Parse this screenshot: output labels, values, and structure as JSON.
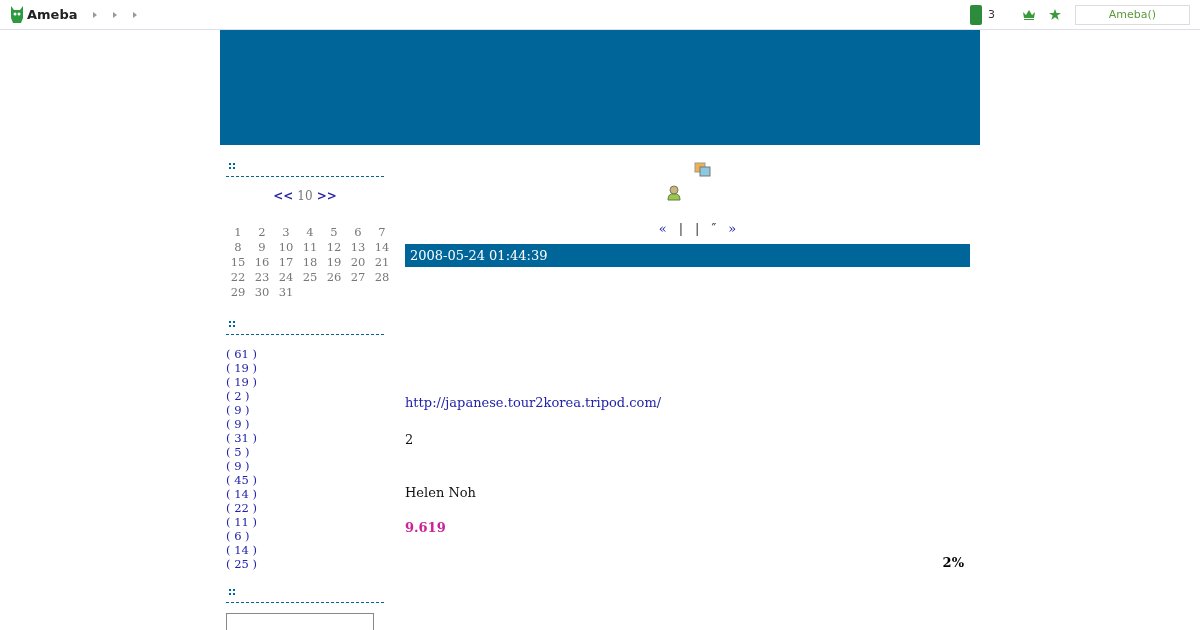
{
  "topbar": {
    "logo": "Ameba",
    "count": "3",
    "account_button": "Ameba()"
  },
  "calendar": {
    "prev": "<<",
    "month": "10",
    "next": ">>",
    "days": [
      "1",
      "2",
      "3",
      "4",
      "5",
      "6",
      "7",
      "8",
      "9",
      "10",
      "11",
      "12",
      "13",
      "14",
      "15",
      "16",
      "17",
      "18",
      "19",
      "20",
      "21",
      "22",
      "23",
      "24",
      "25",
      "26",
      "27",
      "28",
      "29",
      "30",
      "31"
    ]
  },
  "categories": [
    "( 61 )",
    "( 19 )",
    "( 19 )",
    "( 2 )",
    "( 9 )",
    "( 9 )",
    "( 31 )",
    "( 5 )",
    "( 9 )",
    "( 45 )",
    "( 14 )",
    "( 22 )",
    "( 11 )",
    "( 6 )",
    "( 14 )",
    "( 25 )"
  ],
  "pager": [
    "«",
    "|",
    "|",
    "″",
    "»"
  ],
  "entry": {
    "date": "2008-05-24 01:44:39",
    "link": "http://japanese.tour2korea.tripod.com/",
    "line_1": "2",
    "author": "Helen Noh",
    "score": "9.619",
    "percent": "2%"
  }
}
